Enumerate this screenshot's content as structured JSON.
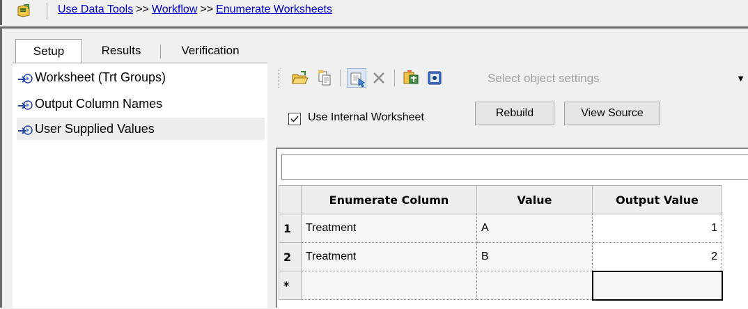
{
  "breadcrumb": {
    "items": [
      "Use Data Tools",
      "Workflow",
      "Enumerate Worksheets"
    ],
    "separator": ">>"
  },
  "tabs": [
    "Setup",
    "Results",
    "Verification"
  ],
  "tree": {
    "items": [
      "Worksheet (Trt Groups)",
      "Output Column Names",
      "User Supplied Values"
    ],
    "selected": "User Supplied Values"
  },
  "toolbar": {
    "icons": [
      "open-folder-icon",
      "copy-icon",
      "edit-icon",
      "delete-icon",
      "import-icon",
      "settings-icon"
    ],
    "select_placeholder": "Select object settings"
  },
  "options": {
    "use_internal_label": "Use Internal Worksheet",
    "use_internal_checked": true,
    "rebuild_label": "Rebuild",
    "view_source_label": "View Source"
  },
  "grid": {
    "headers": [
      "Enumerate Column",
      "Value",
      "Output Value"
    ],
    "rows": [
      {
        "num": "1",
        "enumerate_column": "Treatment",
        "value": "A",
        "output_value": "1"
      },
      {
        "num": "2",
        "enumerate_column": "Treatment",
        "value": "B",
        "output_value": "2"
      }
    ],
    "new_row_marker": "*"
  },
  "colors": {
    "link": "#0000cc",
    "selection_bg": "#eeeeee",
    "header_bg": "#eeeeee"
  }
}
